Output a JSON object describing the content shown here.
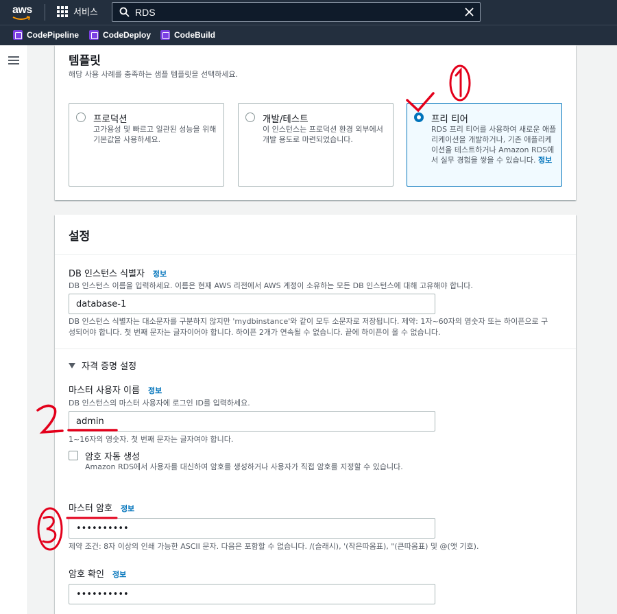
{
  "topnav": {
    "logo": "aws",
    "services_label": "서비스",
    "search_value": "RDS",
    "favorites": [
      "CodePipeline",
      "CodeDeploy",
      "CodeBuild"
    ]
  },
  "template": {
    "title": "템플릿",
    "description": "해당 사용 사례를 충족하는 샘플 템플릿을 선택하세요.",
    "options": [
      {
        "title": "프로덕션",
        "description": "고가용성 및 빠르고 일관된 성능을 위해 기본값을 사용하세요.",
        "selected": false
      },
      {
        "title": "개발/테스트",
        "description": "이 인스턴스는 프로덕션 환경 외부에서 개발 용도로 마련되었습니다.",
        "selected": false
      },
      {
        "title": "프리 티어",
        "description": "RDS 프리 티어를 사용하여 새로운 애플리케이션을 개발하거나, 기존 애플리케이션을 테스트하거나 Amazon RDS에서 실무 경험을 쌓을 수 있습니다.",
        "info": "정보",
        "selected": true
      }
    ]
  },
  "settings": {
    "title": "설정",
    "db_identifier": {
      "label": "DB 인스턴스 식별자",
      "info": "정보",
      "description": "DB 인스턴스 이름을 입력하세요. 이름은 현재 AWS 리전에서 AWS 계정이 소유하는 모든 DB 인스턴스에 대해 고유해야 합니다.",
      "value": "database-1",
      "help": "DB 인스턴스 식별자는 대소문자를 구분하지 않지만 'mydbinstance'와 같이 모두 소문자로 저장됩니다. 제약: 1자~60자의 영숫자 또는 하이픈으로 구성되어야 합니다. 첫 번째 문자는 글자이어야 합니다. 하이픈 2개가 연속될 수 없습니다. 끝에 하이픈이 올 수 없습니다."
    },
    "credentials_toggle": "자격 증명 설정",
    "master_username": {
      "label": "마스터 사용자 이름",
      "info": "정보",
      "description": "DB 인스턴스의 마스터 사용자에 로그인 ID를 입력하세요.",
      "value": "admin",
      "help": "1~16자의 영숫자. 첫 번째 문자는 글자여야 합니다."
    },
    "auto_password": {
      "label": "암호 자동 생성",
      "description": "Amazon RDS에서 사용자를 대신하여 암호를 생성하거나 사용자가 직접 암호를 지정할 수 있습니다.",
      "checked": false
    },
    "master_password": {
      "label": "마스터 암호",
      "info": "정보",
      "value": "••••••••••",
      "help": "제약 조건: 8자 이상의 인쇄 가능한 ASCII 문자. 다음은 포함할 수 없습니다. /(슬래시), '(작은따옴표), \"(큰따옴표) 및 @(앳 기호)."
    },
    "confirm_password": {
      "label": "암호 확인",
      "info": "정보",
      "value": "••••••••••"
    }
  },
  "colors": {
    "nav": "#232f3e",
    "accent": "#0073bb",
    "annotation": "#e3001b"
  }
}
